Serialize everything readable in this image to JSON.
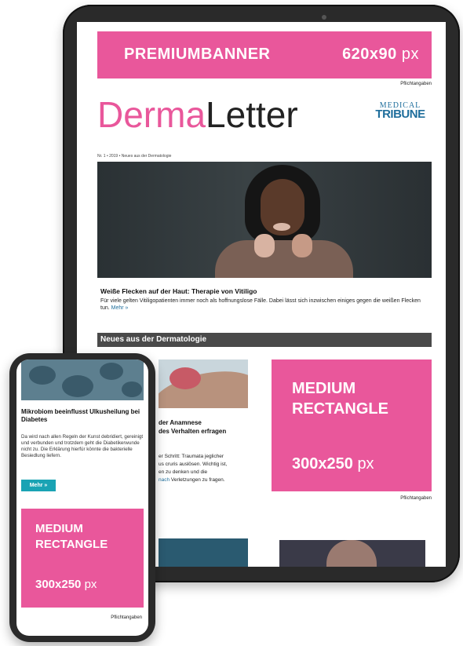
{
  "tablet": {
    "premium_banner": {
      "label": "PREMIUMBANNER",
      "size": "620x90",
      "unit": "px"
    },
    "pflichtangaben": "Pflichtangaben",
    "logo": {
      "part1": "Derma",
      "part2": "Letter"
    },
    "publisher": {
      "line1": "MEDICAL",
      "line2": "TRIBUNE"
    },
    "issue_line": "Nr. 1 • 2019 • Neues aus der Dermatologie",
    "lead_article": {
      "title": "Weiße Flecken auf der Haut: Therapie von Vitiligo",
      "text": "Für viele gelten Vitiligopatienten immer noch als hoffnungslose Fälle. Dabei lässt sich inzwischen einiges gegen die weißen Flecken tun.",
      "more": "Mehr »"
    },
    "section_title": "Neues aus der Dermatologie",
    "article2": {
      "title_line1": "der Anamnese",
      "title_line2": "des Verhalten erfragen",
      "text_line1": "er Schritt: Traumata jeglicher",
      "text_line2": "us cruris auslösen. Wichtig ist,",
      "text_line3": "en zu denken und die",
      "text_line4_blue": "nach",
      "text_line4": "Verletzungen zu fragen."
    },
    "medium_rectangle": {
      "line1": "MEDIUM",
      "line2": "RECTANGLE",
      "size": "300x250",
      "unit": "px"
    },
    "pflichtangaben_2": "Pflichtangaben"
  },
  "phone": {
    "article": {
      "title": "Mikrobiom beeinflusst Ulkusheilung bei Diabetes",
      "text": "Da wird nach allen Regeln der Kunst debridiert, gereinigt und verbunden und trotzdem geht die Diabetikerwunde nicht zu. Die Erklärung hierfür könnte die bakterielle Besiedlung liefern.",
      "button": "Mehr »"
    },
    "medium_rectangle": {
      "line1": "MEDIUM",
      "line2": "RECTANGLE",
      "size": "300x250",
      "unit": "px"
    },
    "pflichtangaben": "Pflichtangaben"
  },
  "colors": {
    "brand_pink": "#e9579b",
    "accent_teal": "#1aa3b4",
    "publisher_blue": "#1f6e9c",
    "section_bar": "#4a4a4a"
  }
}
